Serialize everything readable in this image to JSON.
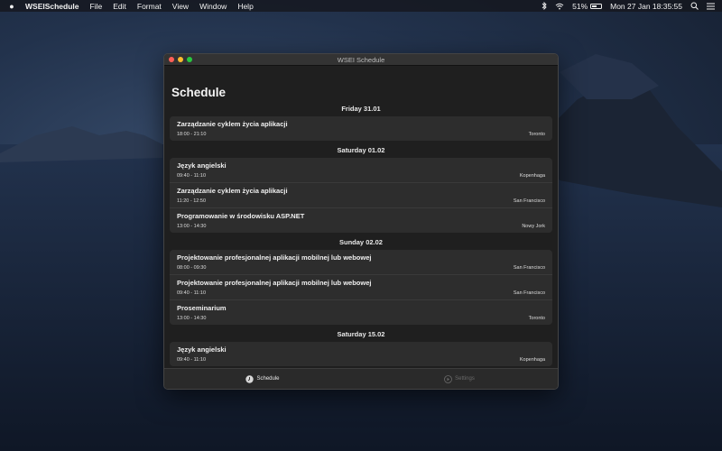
{
  "menubar": {
    "app_name": "WSEISchedule",
    "menus": [
      "File",
      "Edit",
      "Format",
      "View",
      "Window",
      "Help"
    ],
    "battery_percent": "51%",
    "battery_level": 0.51,
    "clock": "Mon 27 Jan  18:35:55"
  },
  "window": {
    "title": "WSEI Schedule",
    "page_title": "Schedule"
  },
  "schedule": [
    {
      "day": "Friday 31.01",
      "items": [
        {
          "title": "Zarządzanie cyklem życia aplikacji",
          "time": "18:00 - 21:10",
          "location": "Toronto"
        }
      ]
    },
    {
      "day": "Saturday 01.02",
      "items": [
        {
          "title": "Język angielski",
          "time": "09:40 - 11:10",
          "location": "Kopenhaga"
        },
        {
          "title": "Zarządzanie cyklem życia aplikacji",
          "time": "11:20 - 12:50",
          "location": "San Francisco"
        },
        {
          "title": "Programowanie w środowisku ASP.NET",
          "time": "13:00 - 14:30",
          "location": "Nowy Jork"
        }
      ]
    },
    {
      "day": "Sunday 02.02",
      "items": [
        {
          "title": "Projektowanie profesjonalnej aplikacji mobilnej lub webowej",
          "time": "08:00 - 09:30",
          "location": "San Francisco"
        },
        {
          "title": "Projektowanie profesjonalnej aplikacji mobilnej lub webowej",
          "time": "09:40 - 11:10",
          "location": "San Francisco"
        },
        {
          "title": "Proseminarium",
          "time": "13:00 - 14:30",
          "location": "Toronto"
        }
      ]
    },
    {
      "day": "Saturday 15.02",
      "items": [
        {
          "title": "Język angielski",
          "time": "09:40 - 11:10",
          "location": "Kopenhaga"
        }
      ]
    }
  ],
  "tabs": {
    "schedule": "Schedule",
    "settings": "Settings"
  }
}
